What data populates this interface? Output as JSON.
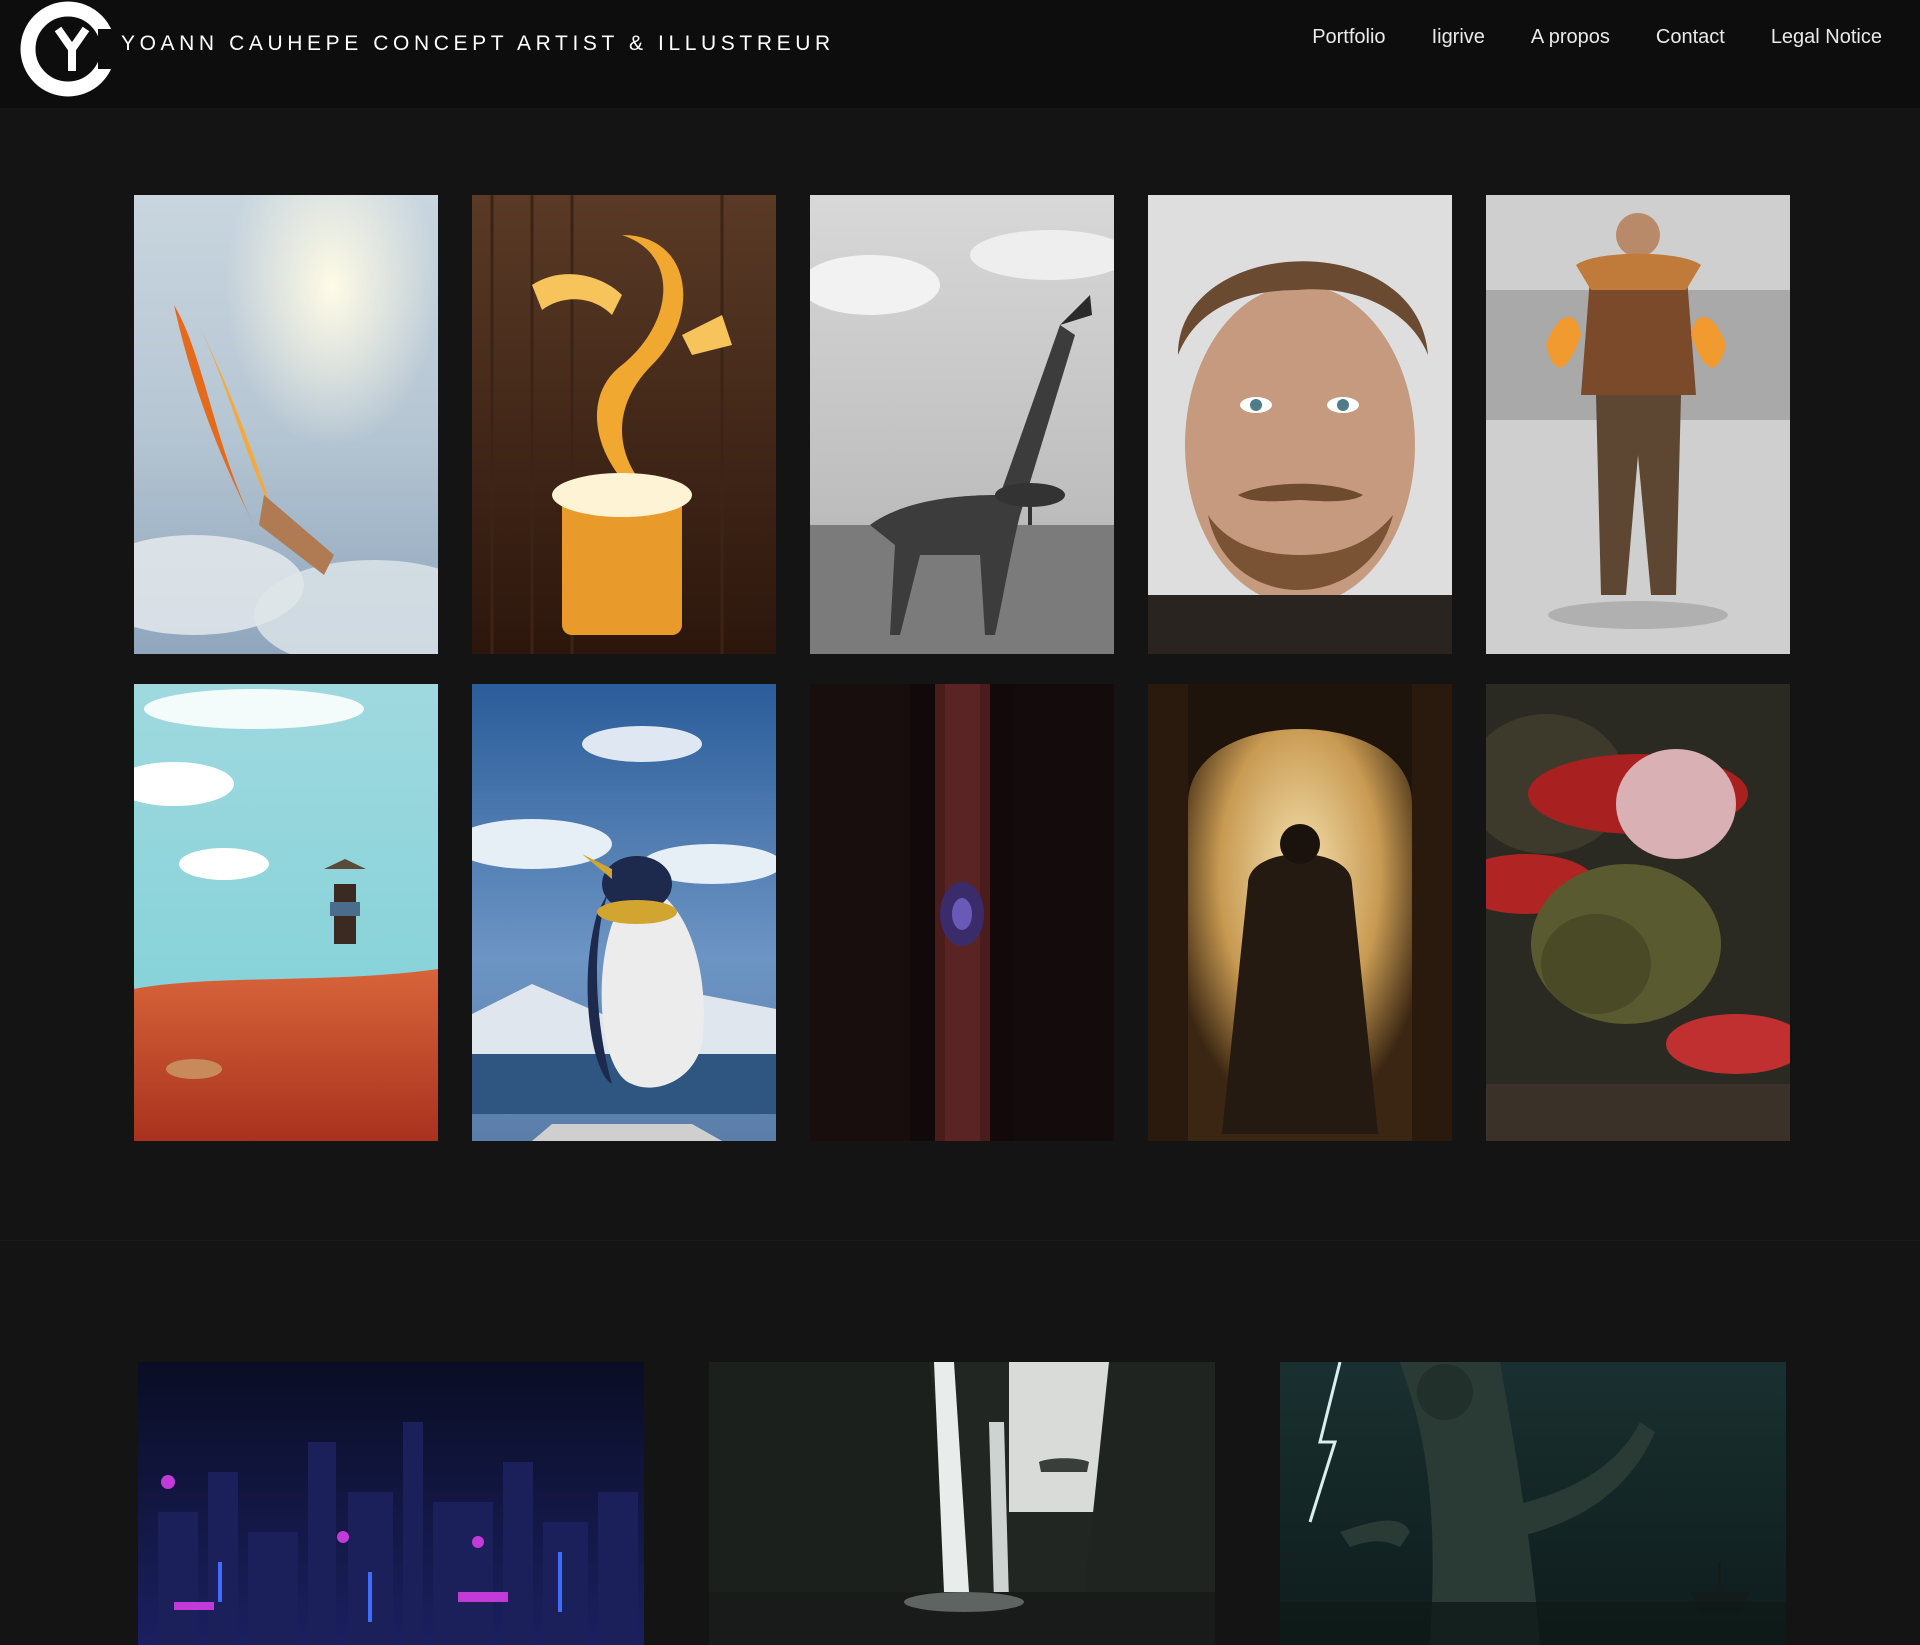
{
  "header": {
    "logo_letters": "CY",
    "site_title": "YOANN CAUHEPE CONCEPT ARTIST & ILLUSTREUR",
    "bg_color": "#0d0d0d"
  },
  "nav": {
    "items": [
      {
        "label": "Portfolio"
      },
      {
        "label": "Iigrive"
      },
      {
        "label": "A propos"
      },
      {
        "label": "Contact"
      },
      {
        "label": "Legal Notice"
      }
    ]
  },
  "gallery": {
    "row1": [
      {
        "subject": "burning angel falling from sky",
        "icon": "artwork-thumbnail"
      },
      {
        "subject": "beer spirit rising from mug",
        "icon": "artwork-thumbnail"
      },
      {
        "subject": "armored giraffe on savanna",
        "icon": "artwork-thumbnail"
      },
      {
        "subject": "bearded man portrait",
        "icon": "artwork-thumbnail"
      },
      {
        "subject": "fire-handed warrior character",
        "icon": "artwork-thumbnail"
      }
    ],
    "row2": [
      {
        "subject": "wanderer on red desert",
        "icon": "artwork-thumbnail"
      },
      {
        "subject": "penguin creature on iceberg",
        "icon": "artwork-thumbnail"
      },
      {
        "subject": "dark pillar with glowing emblem",
        "icon": "artwork-thumbnail"
      },
      {
        "subject": "knight in glowing doorway",
        "icon": "artwork-thumbnail"
      },
      {
        "subject": "mushroom creature in cave",
        "icon": "artwork-thumbnail"
      }
    ],
    "row3": [
      {
        "subject": "neon cyberpunk city",
        "icon": "artwork-thumbnail"
      },
      {
        "subject": "waterfall canyon with bridge",
        "icon": "artwork-thumbnail"
      },
      {
        "subject": "sea monster in storm",
        "icon": "artwork-thumbnail"
      }
    ]
  },
  "colors": {
    "page_bg": "#141414",
    "nav_text": "#e9e9e9",
    "title_text": "#ffffff"
  }
}
